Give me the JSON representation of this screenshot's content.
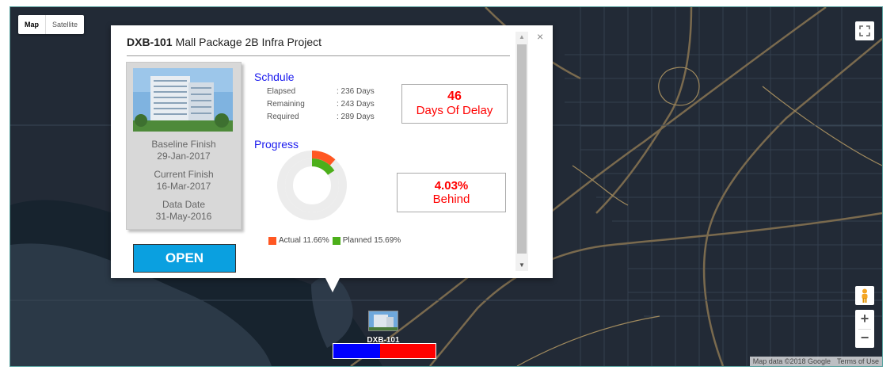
{
  "map": {
    "type_options": [
      "Map",
      "Satellite"
    ],
    "attribution": "Map data ©2018 Google",
    "terms": "Terms of Use",
    "zoom_in": "+",
    "zoom_out": "−",
    "marker_label": "DXB-101"
  },
  "popup": {
    "code": "DXB-101",
    "name": "Mall Package 2B Infra Project",
    "close": "×",
    "baseline_label": "Baseline Finish",
    "baseline_value": "29-Jan-2017",
    "current_label": "Current Finish",
    "current_value": "16-Mar-2017",
    "data_label": "Data Date",
    "data_value": "31-May-2016",
    "open_label": "OPEN",
    "schedule": {
      "title": "Schdule",
      "rows": [
        {
          "label": "Elapsed",
          "value": ": 236 Days"
        },
        {
          "label": "Remaining",
          "value": ": 243 Days"
        },
        {
          "label": "Required",
          "value": ": 289 Days"
        }
      ],
      "delay_value": "46",
      "delay_label": "Days Of Delay"
    },
    "progress": {
      "title": "Progress",
      "actual_label": "Actual 11.66%",
      "planned_label": "Planned 15.69%",
      "actual_fraction": 0.1166,
      "planned_fraction": 0.1569,
      "behind_value": "4.03%",
      "behind_label": "Behind"
    }
  },
  "colors": {
    "actual": "#ff5722",
    "planned": "#4caf1a",
    "delay": "#ff0000",
    "open_button": "#0aa0e0",
    "section_title": "#1a1aee"
  },
  "progress_bar": {
    "blue_fraction": 0.46
  }
}
